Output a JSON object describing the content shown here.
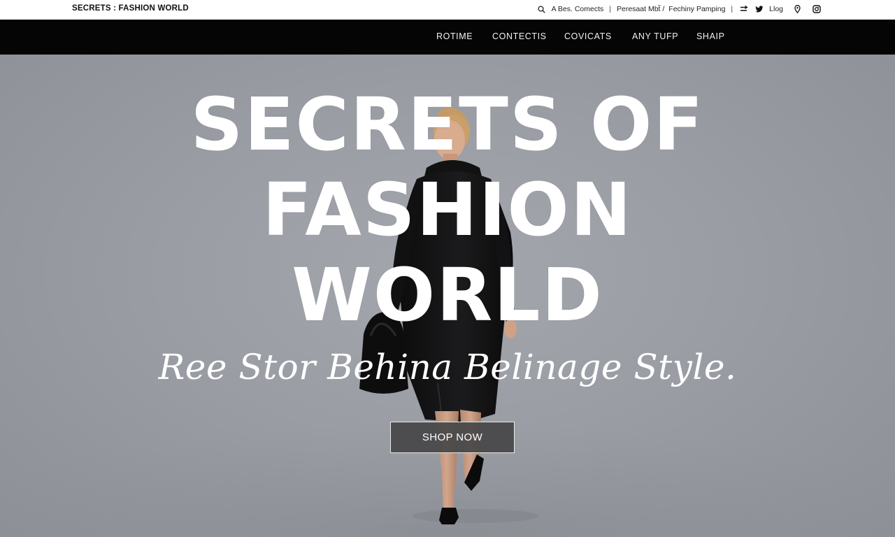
{
  "brand": {
    "name": "SECRETS : FASHION WORLD"
  },
  "utility": {
    "search_icon": "search-icon",
    "link_1": "A Bes. Comects",
    "link_2": "Peresaat Mbt̃ /",
    "link_3": "Fechiny Pamping",
    "menu_icon": "menu-arrows-icon",
    "twitter_icon": "twitter-icon",
    "log_label": "Llog",
    "location_icon": "location-pin-icon",
    "instagram_icon": "instagram-icon"
  },
  "nav": {
    "items": [
      "ROTIME",
      "CONTECTIS",
      "COVICATS",
      "ANY TUFP",
      "SHAIP"
    ]
  },
  "hero": {
    "title_lines": [
      "SECRETS OF",
      "FASHION",
      "WORLD"
    ],
    "tagline": "Ree Stor Behina Belinage Style.",
    "cta_label": "SHOP NOW"
  },
  "colors": {
    "nav_bg": "#050505",
    "hero_bg": "#9b9ea5",
    "text_light": "#ffffff",
    "button_bg": "#464648"
  }
}
